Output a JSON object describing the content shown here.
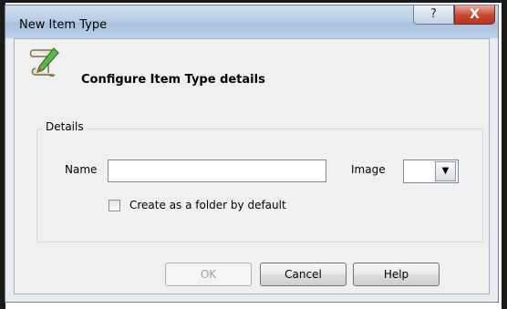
{
  "window": {
    "title": "New Item Type",
    "help_glyph": "?",
    "close_glyph": "X"
  },
  "header": {
    "icon": "scroll-pencil-icon",
    "text": "Configure Item Type details"
  },
  "details": {
    "legend": "Details",
    "name_label": "Name",
    "name_value": "",
    "image_label": "Image",
    "image_value": "",
    "image_dropdown_glyph": "▼",
    "folder_checkbox_label": "Create as a folder by default",
    "folder_checked": false
  },
  "buttons": {
    "ok": "OK",
    "ok_enabled": false,
    "cancel": "Cancel",
    "help": "Help"
  },
  "colors": {
    "titlebar": "#b9cde6",
    "close_button": "#c7462f",
    "client_bg": "#f0f0f0"
  }
}
